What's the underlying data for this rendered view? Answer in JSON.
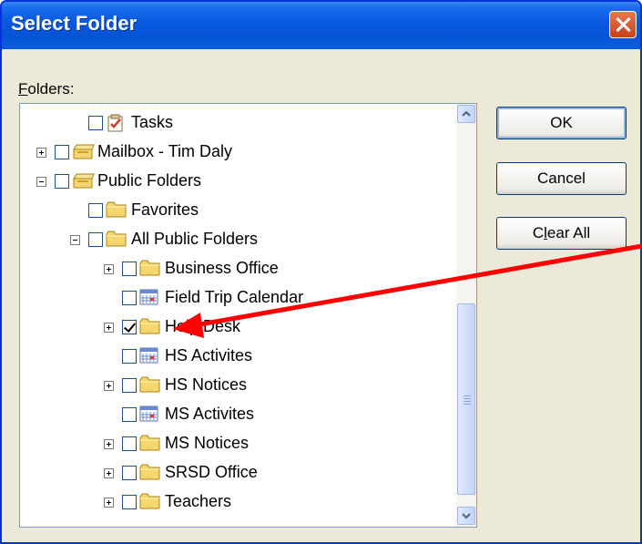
{
  "window": {
    "title": "Select Folder"
  },
  "folders_label": {
    "accel": "F",
    "rest": "olders:"
  },
  "tree": [
    {
      "label": "Tasks",
      "icon": "tasks-icon",
      "expander": "none",
      "checked": false,
      "indent": 3
    },
    {
      "label": "Mailbox - Tim Daly",
      "icon": "mailbox-icon",
      "expander": "plus",
      "checked": false,
      "indent": 2
    },
    {
      "label": "Public Folders",
      "icon": "public-folders-icon",
      "expander": "minus",
      "checked": false,
      "indent": 2
    },
    {
      "label": "Favorites",
      "icon": "folder-icon",
      "expander": "none",
      "checked": false,
      "indent": 3
    },
    {
      "label": "All Public Folders",
      "icon": "folder-icon",
      "expander": "minus",
      "checked": false,
      "indent": 3
    },
    {
      "label": "Business Office",
      "icon": "folder-icon",
      "expander": "plus",
      "checked": false,
      "indent": 4
    },
    {
      "label": "Field Trip Calendar",
      "icon": "calendar-icon",
      "expander": "none",
      "checked": false,
      "indent": 4
    },
    {
      "label": "Help Desk",
      "icon": "folder-icon",
      "expander": "plus",
      "checked": true,
      "indent": 4
    },
    {
      "label": "HS Activites",
      "icon": "calendar-icon",
      "expander": "none",
      "checked": false,
      "indent": 4
    },
    {
      "label": "HS Notices",
      "icon": "folder-icon",
      "expander": "plus",
      "checked": false,
      "indent": 4
    },
    {
      "label": "MS Activites",
      "icon": "calendar-icon",
      "expander": "none",
      "checked": false,
      "indent": 4
    },
    {
      "label": "MS Notices",
      "icon": "folder-icon",
      "expander": "plus",
      "checked": false,
      "indent": 4
    },
    {
      "label": "SRSD Office",
      "icon": "folder-icon",
      "expander": "plus",
      "checked": false,
      "indent": 4
    },
    {
      "label": "Teachers",
      "icon": "folder-icon",
      "expander": "plus",
      "checked": false,
      "indent": 4
    }
  ],
  "buttons": {
    "ok": "OK",
    "cancel": "Cancel",
    "clear_pre": "C",
    "clear_accel": "l",
    "clear_post": "ear All"
  },
  "colors": {
    "title_bar": "#0a5ae0",
    "annotation_arrow": "#ff0000",
    "folder": "#f5d46a"
  }
}
